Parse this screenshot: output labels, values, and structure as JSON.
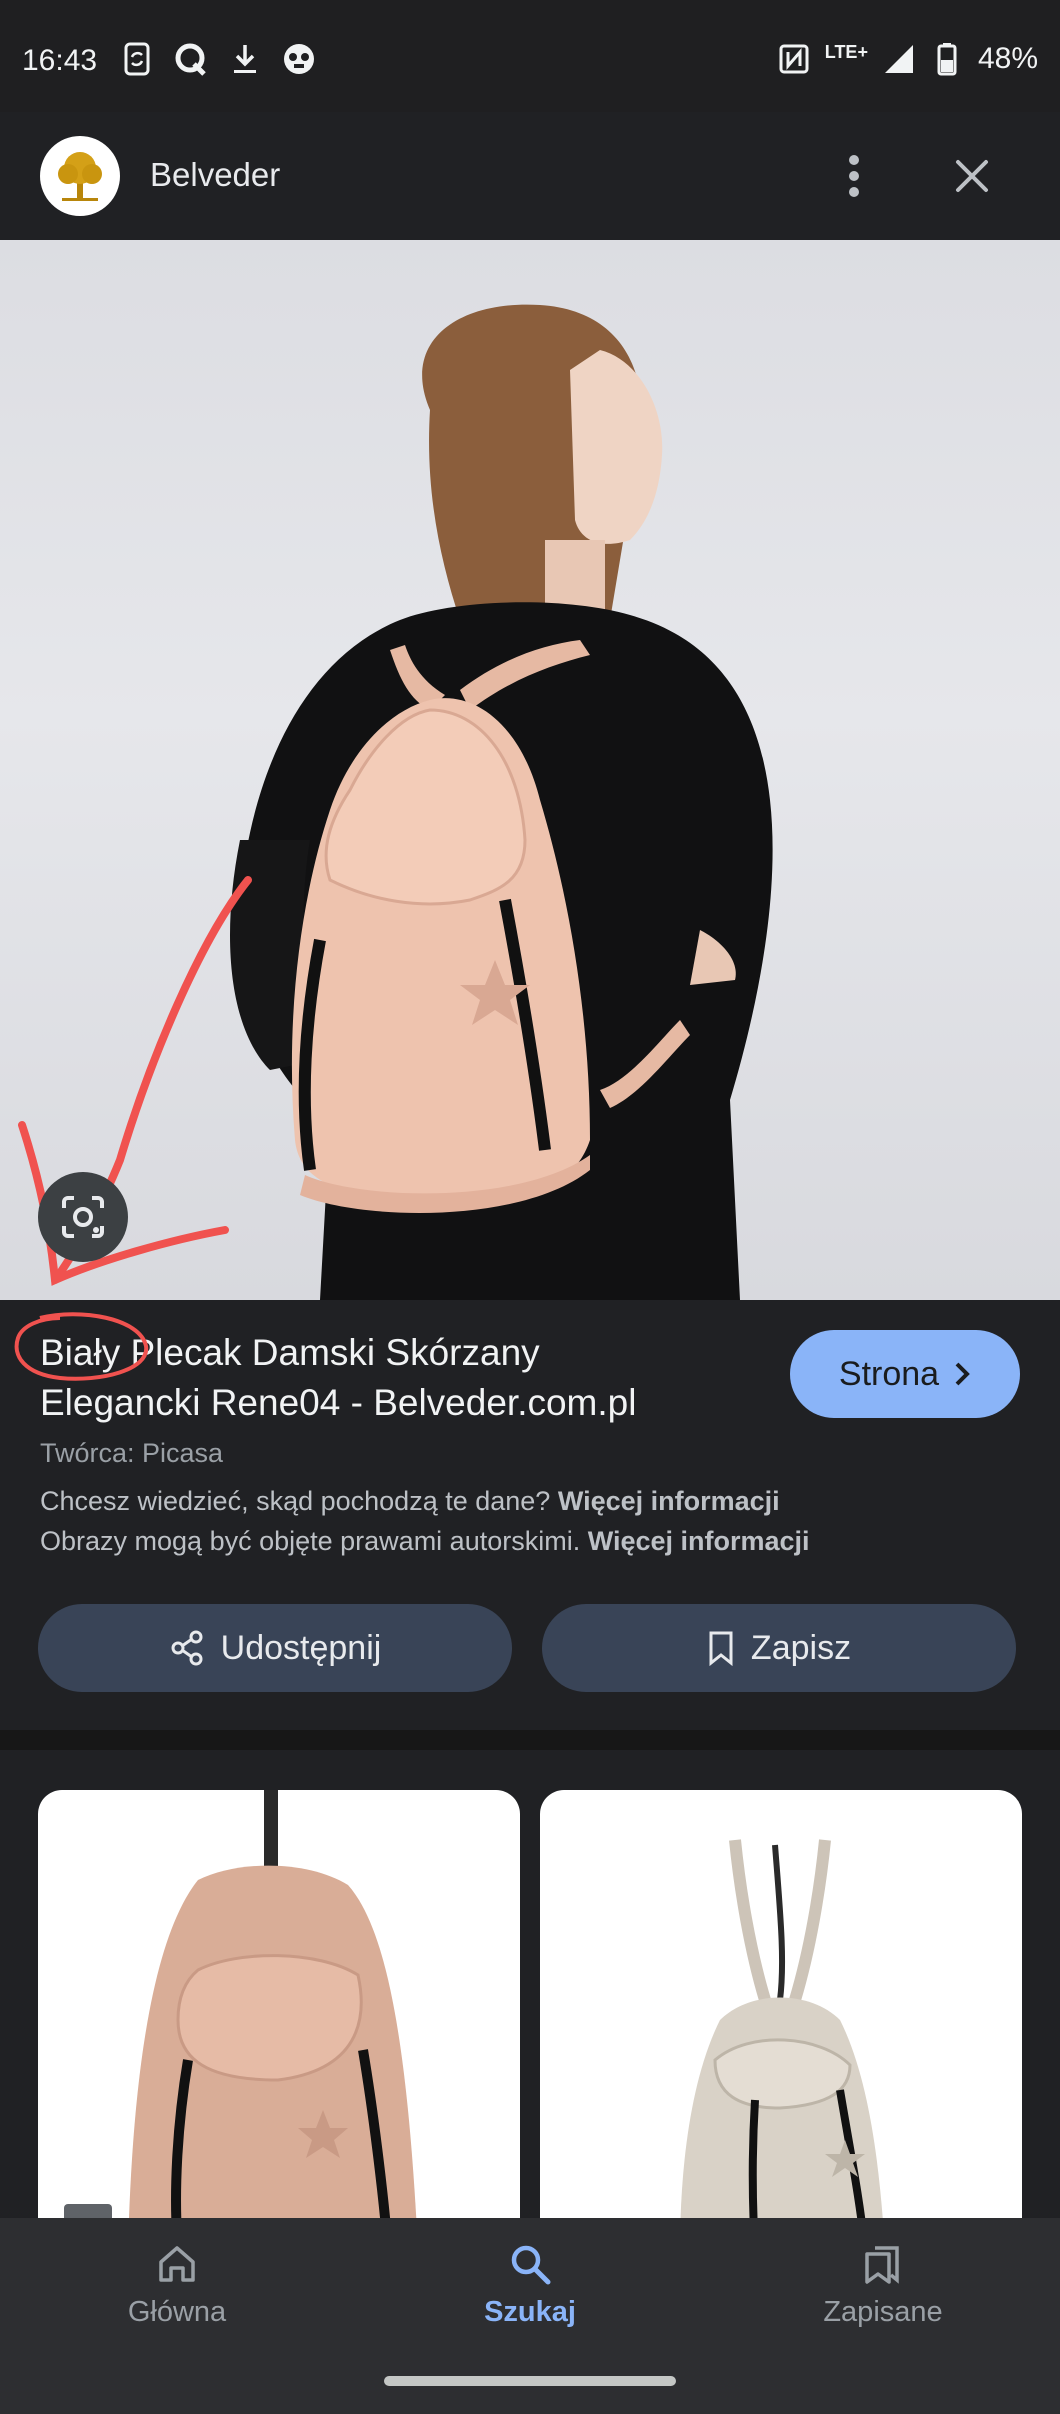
{
  "status_bar": {
    "time": "16:43",
    "network": "LTE+",
    "battery": "48%",
    "left_icons": [
      "sync-icon",
      "q-app-icon",
      "download-icon",
      "game-icon"
    ],
    "right_icons": [
      "nfc-icon",
      "signal-icon",
      "battery-icon"
    ]
  },
  "header": {
    "site_name": "Belveder",
    "logo": "belveder-tree-logo",
    "menu_icon": "more-vert-icon",
    "close_icon": "close-icon"
  },
  "result": {
    "title_line1": "Biały Plecak Damski Skórzany",
    "title_line2": "Elegancki Rene04 - Belveder.com.pl",
    "visit_label": "Strona",
    "creator": "Twórca: Picasa",
    "info_text_1": "Chcesz wiedzieć, skąd pochodzą te dane?",
    "info_more_1": "Więcej informacji",
    "info_text_2": "Obrazy mogą być objęte prawami autorskimi.",
    "info_more_2": "Więcej informacji",
    "share_label": "Udostępnij",
    "save_label": "Zapisz"
  },
  "bottom_nav": {
    "items": [
      {
        "label": "Główna",
        "icon": "home-icon"
      },
      {
        "label": "Szukaj",
        "icon": "search-icon",
        "active": true
      },
      {
        "label": "Zapisane",
        "icon": "saved-icon"
      }
    ]
  },
  "colors": {
    "background": "#202124",
    "accent": "#8ab4f8",
    "button_bg": "#394457",
    "annotation_red": "#f0524f",
    "bag_pink": "#eec3ae"
  }
}
